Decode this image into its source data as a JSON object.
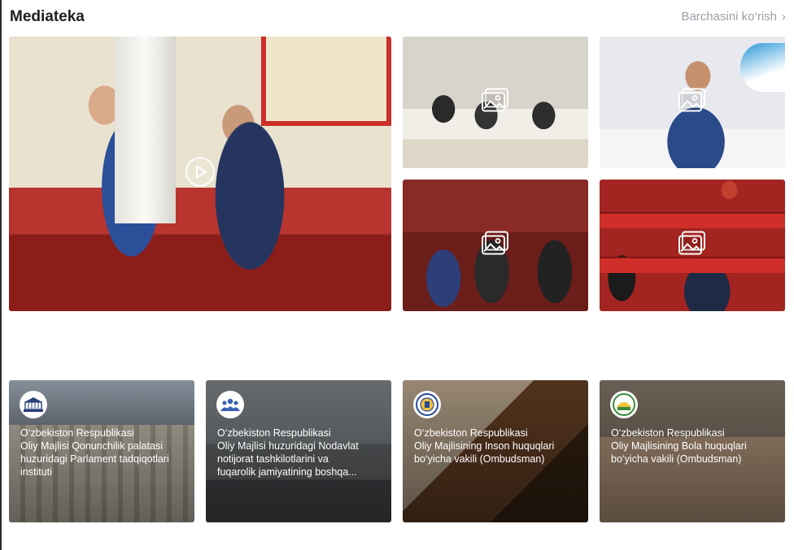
{
  "header": {
    "title": "Mediateka",
    "see_all_label": "Barchasini ko‘rish"
  },
  "media": [
    {
      "type": "video",
      "icon": "play-icon"
    },
    {
      "type": "photo",
      "icon": "gallery-icon"
    },
    {
      "type": "photo",
      "icon": "gallery-icon"
    },
    {
      "type": "photo",
      "icon": "gallery-icon"
    },
    {
      "type": "photo",
      "icon": "gallery-icon"
    }
  ],
  "cards": [
    {
      "line1": "O‘zbekiston Respublikasi",
      "line2": "Oliy Majlisi Qonunchilik palatasi",
      "line3": "huzuridagi Parlament tadqiqotlari",
      "line4": "instituti",
      "logo": "parliament-logo-icon"
    },
    {
      "line1": "O‘zbekiston Respublikasi",
      "line2": "Oliy Majlisi huzuridagi Nodavlat",
      "line3": "notijorat tashkilotlarini va",
      "line4": "fuqarolik jamiyatining boshqa...",
      "logo": "people-logo-icon"
    },
    {
      "line1": "O‘zbekiston Respublikasi",
      "line2": "Oliy Majlisining Inson huquqlari",
      "line3": "bo‘yicha vakili (Ombudsman)",
      "line4": "",
      "logo": "ombudsman-logo-icon"
    },
    {
      "line1": "O‘zbekiston Respublikasi",
      "line2": "Oliy Majlisining Bola huquqlari",
      "line3": "bo‘yicha vakili (Ombudsman)",
      "line4": "",
      "logo": "child-ombudsman-logo-icon"
    }
  ]
}
